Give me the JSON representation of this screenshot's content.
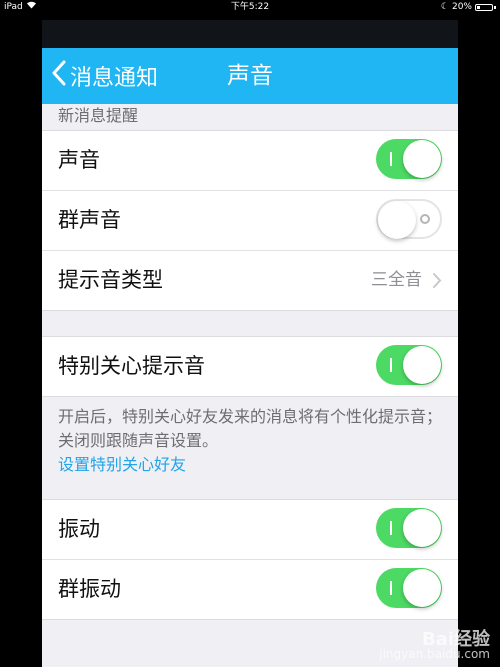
{
  "status_bar": {
    "device": "iPad",
    "time": "下午5:22",
    "battery": "20%"
  },
  "nav": {
    "back_label": "消息通知",
    "title": "声音"
  },
  "section_header": "新消息提醒",
  "group1": [
    {
      "label": "声音",
      "type": "toggle",
      "on": true
    },
    {
      "label": "群声音",
      "type": "toggle",
      "on": false
    },
    {
      "label": "提示音类型",
      "type": "value",
      "value": "三全音"
    }
  ],
  "special": {
    "label": "特别关心提示音",
    "on": true,
    "description": "开启后，特别关心好友发来的消息将有个性化提示音；关闭则跟随声音设置。",
    "link": "设置特别关心好友"
  },
  "group3": [
    {
      "label": "振动",
      "type": "toggle",
      "on": true
    },
    {
      "label": "群振动",
      "type": "toggle",
      "on": true
    }
  ],
  "watermark": {
    "brand": "Bai经验",
    "url": "jingyan.baidu.com"
  },
  "colors": {
    "nav_blue": "#1fb6f3",
    "toggle_green": "#4cd964",
    "link_blue": "#1fa5e8"
  }
}
